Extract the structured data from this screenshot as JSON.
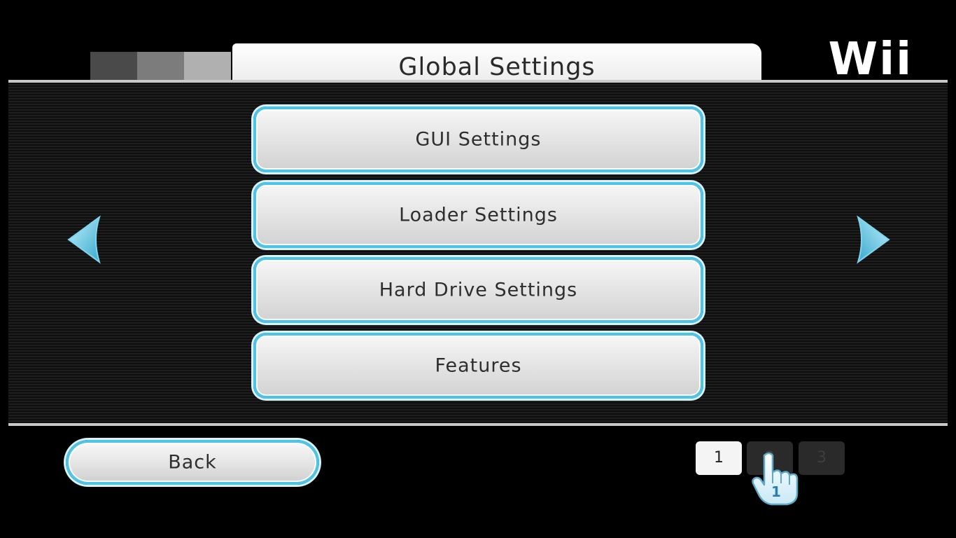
{
  "header": {
    "title": "Global Settings",
    "brand": "Wii"
  },
  "menu": {
    "items": [
      {
        "label": "GUI Settings"
      },
      {
        "label": "Loader Settings"
      },
      {
        "label": "Hard Drive Settings"
      },
      {
        "label": "Features"
      }
    ]
  },
  "navigation": {
    "prev_icon": "left-arrow-icon",
    "next_icon": "right-arrow-icon"
  },
  "footer": {
    "back_label": "Back",
    "pages": [
      "1",
      "2",
      "3"
    ],
    "current_page": "1"
  },
  "pointer": {
    "icon": "hand-pointer-icon",
    "player_number": "1"
  },
  "colors": {
    "accent": "#4fc3e6",
    "background": "#000000",
    "button_face": "#e6e6e6",
    "text": "#2e2e2e"
  }
}
